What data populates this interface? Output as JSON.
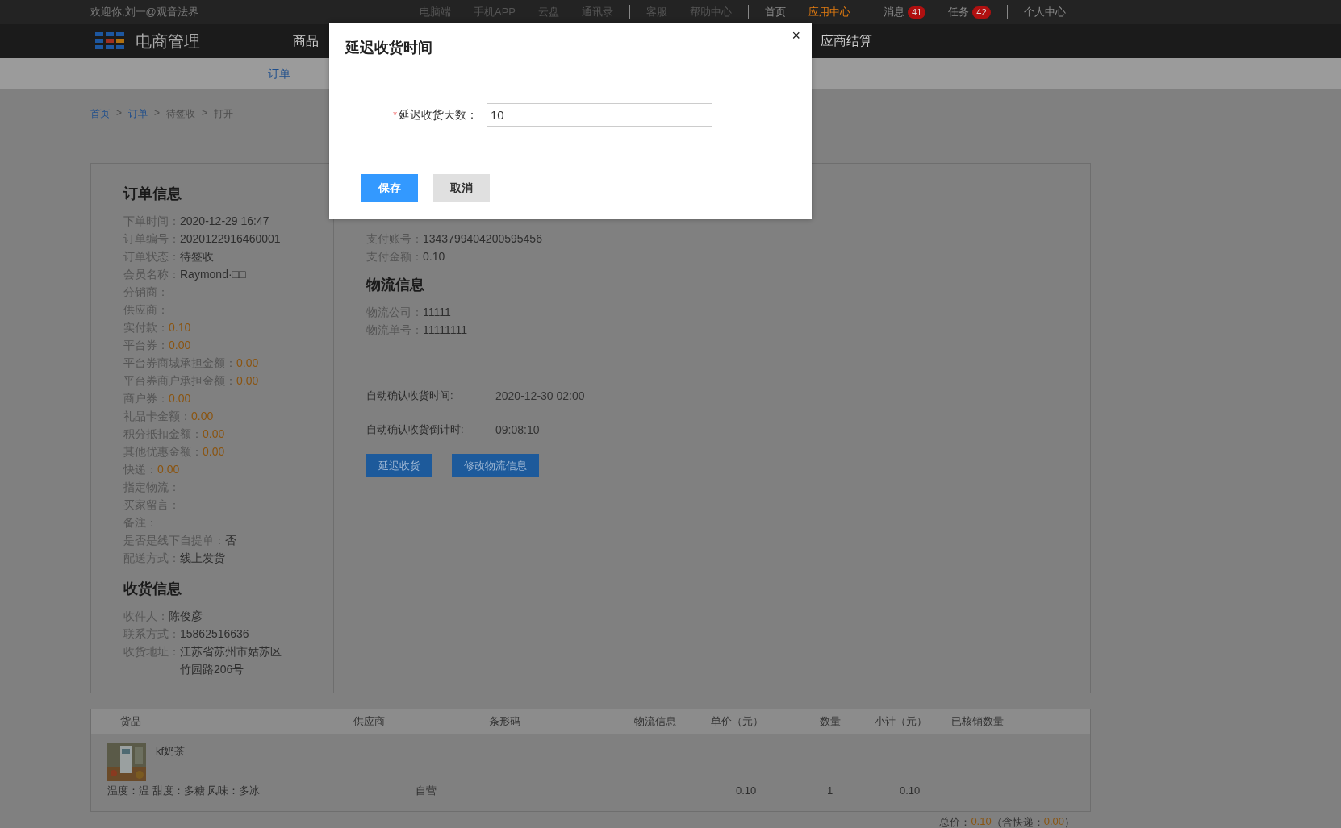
{
  "top_bar": {
    "welcome": "欢迎你,刘一@观音法界",
    "groups": [
      [
        {
          "label": "电脑端",
          "disabled": true,
          "selected": false
        },
        {
          "label": "手机APP",
          "disabled": true,
          "selected": false
        },
        {
          "label": "云盘",
          "disabled": true,
          "selected": false
        },
        {
          "label": "通讯录",
          "disabled": true,
          "selected": false
        }
      ],
      [
        {
          "label": "客服",
          "disabled": true,
          "selected": false
        },
        {
          "label": "帮助中心",
          "disabled": true,
          "selected": false
        }
      ],
      [
        {
          "label": "首页",
          "disabled": false,
          "selected": false
        },
        {
          "label": "应用中心",
          "disabled": false,
          "selected": true
        }
      ],
      [
        {
          "label": "消息",
          "disabled": false,
          "selected": false,
          "badge": "41"
        },
        {
          "label": "任务",
          "disabled": false,
          "selected": false,
          "badge": "42"
        }
      ],
      [
        {
          "label": "个人中心",
          "disabled": false,
          "selected": false
        }
      ]
    ]
  },
  "header": {
    "title": "电商管理",
    "nav": [
      {
        "label": "商品"
      },
      {
        "label": "应商结算"
      }
    ]
  },
  "subnav": [
    {
      "label": "订单",
      "selected": true
    }
  ],
  "breadcrumb": [
    {
      "label": "首页",
      "link": true
    },
    {
      "label": "订单",
      "link": true
    },
    {
      "label": "待签收",
      "link": false
    },
    {
      "label": "打开",
      "link": false
    }
  ],
  "breadcrumb_separator": ">",
  "order_info": {
    "title": "订单信息",
    "rows": [
      {
        "label": "下单时间：",
        "value": "2020-12-29 16:47",
        "highlight": false
      },
      {
        "label": "订单编号：",
        "value": "2020122916460001",
        "highlight": false
      },
      {
        "label": "订单状态：",
        "value": "待签收",
        "highlight": false
      },
      {
        "label": "会员名称：",
        "value": "Raymond·□□",
        "highlight": false
      },
      {
        "label": "分销商："
      },
      {
        "label": "供应商："
      },
      {
        "label": "实付款：",
        "value": "0.10",
        "highlight": true
      },
      {
        "label": "平台券：",
        "value": "0.00",
        "highlight": true
      },
      {
        "label": "平台券商城承担金额：",
        "value": "0.00",
        "highlight": true
      },
      {
        "label": "平台券商户承担金额：",
        "value": "0.00",
        "highlight": true
      },
      {
        "label": "商户券：",
        "value": "0.00",
        "highlight": true
      },
      {
        "label": "礼品卡金额：",
        "value": "0.00",
        "highlight": true
      },
      {
        "label": "积分抵扣金额：",
        "value": "0.00",
        "highlight": true
      },
      {
        "label": "其他优惠金额：",
        "value": "0.00",
        "highlight": true
      },
      {
        "label": "快递：",
        "value": "0.00",
        "highlight": true
      },
      {
        "label": "指定物流："
      },
      {
        "label": "买家留言："
      },
      {
        "label": "备注："
      },
      {
        "label": "是否是线下自提单：",
        "value": "否",
        "highlight": false
      },
      {
        "label": "配送方式：",
        "value": "线上发货",
        "highlight": false
      }
    ]
  },
  "shipping_info": {
    "title": "收货信息",
    "rows": [
      {
        "label": "收件人：",
        "value": "陈俊彦",
        "highlight": false
      },
      {
        "label": "联系方式：",
        "value": "15862516636",
        "highlight": false
      },
      {
        "label": "收货地址：",
        "value": "江苏省苏州市姑苏区竹园路206号",
        "highlight": false
      }
    ]
  },
  "payment": {
    "rows": [
      {
        "label": "支付账号：",
        "value": "1343799404200595456"
      },
      {
        "label": "支付金额：",
        "value": "0.10"
      }
    ]
  },
  "logistics": {
    "title": "物流信息",
    "rows": [
      {
        "label": "物流公司：",
        "value": "11111"
      },
      {
        "label": "物流单号：",
        "value": "11111111"
      }
    ]
  },
  "auto_confirm": [
    {
      "label": "自动确认收货时间:",
      "value": "2020-12-30 02:00"
    },
    {
      "label": "自动确认收货倒计时:",
      "value": "09:08:10"
    }
  ],
  "actions": [
    "延迟收货",
    "修改物流信息"
  ],
  "table": {
    "columns": [
      "货品",
      "供应商",
      "条形码",
      "物流信息",
      "单价（元）",
      "数量",
      "小计（元）",
      "已核销数量"
    ],
    "rows": [
      {
        "name": "kf奶茶",
        "spec": "温度：温 甜度：多糖 风味：多冰",
        "supplier": "自营",
        "price": "0.10",
        "quantity": "1",
        "subtotal": "0.10"
      }
    ]
  },
  "total": {
    "label": "总价：",
    "value": "0.10",
    "shipping_label": "（含快递：",
    "shipping_value": "0.00",
    "close": "）"
  },
  "modal": {
    "title": "延迟收货时间",
    "close": "×",
    "field": {
      "label": "延迟收货天数：",
      "required": true,
      "required_mark": "*",
      "value": "10"
    },
    "buttons": [
      {
        "label": "保存",
        "kind": "primary"
      },
      {
        "label": "取消",
        "kind": "secondary"
      }
    ]
  }
}
